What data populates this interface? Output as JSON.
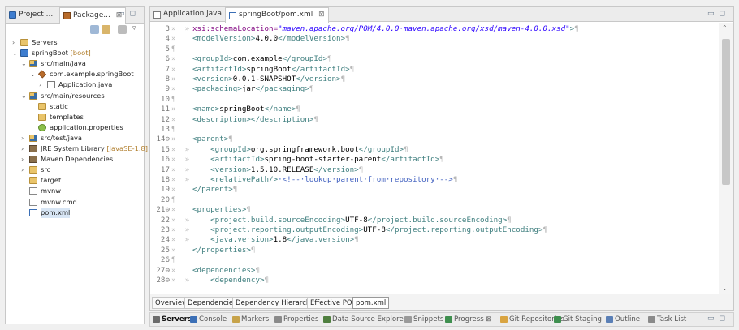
{
  "left_panel": {
    "tabs": [
      {
        "label": "Project ...",
        "active": false
      },
      {
        "label": "Package...",
        "active": true,
        "close": "⊠"
      }
    ],
    "tree": [
      {
        "label": "Servers",
        "decoration": "",
        "depth": 0,
        "twisty": "›",
        "icon": "folder"
      },
      {
        "label": "springBoot",
        "decoration": "[boot]",
        "depth": 0,
        "twisty": "⌄",
        "icon": "project"
      },
      {
        "label": "src/main/java",
        "decoration": "",
        "depth": 1,
        "twisty": "⌄",
        "icon": "srcfolder"
      },
      {
        "label": "com.example.springBoot",
        "decoration": "",
        "depth": 2,
        "twisty": "⌄",
        "icon": "package"
      },
      {
        "label": "Application.java",
        "decoration": "",
        "depth": 3,
        "twisty": "›",
        "icon": "java"
      },
      {
        "label": "src/main/resources",
        "decoration": "",
        "depth": 1,
        "twisty": "⌄",
        "icon": "srcfolder"
      },
      {
        "label": "static",
        "decoration": "",
        "depth": 2,
        "twisty": "",
        "icon": "folder"
      },
      {
        "label": "templates",
        "decoration": "",
        "depth": 2,
        "twisty": "",
        "icon": "folder"
      },
      {
        "label": "application.properties",
        "decoration": "",
        "depth": 2,
        "twisty": "",
        "icon": "props"
      },
      {
        "label": "src/test/java",
        "decoration": "",
        "depth": 1,
        "twisty": "›",
        "icon": "srcfolder"
      },
      {
        "label": "JRE System Library",
        "decoration": "[JavaSE-1.8]",
        "depth": 1,
        "twisty": "›",
        "icon": "lib"
      },
      {
        "label": "Maven Dependencies",
        "decoration": "",
        "depth": 1,
        "twisty": "›",
        "icon": "lib"
      },
      {
        "label": "src",
        "decoration": "",
        "depth": 1,
        "twisty": "›",
        "icon": "folder"
      },
      {
        "label": "target",
        "decoration": "",
        "depth": 1,
        "twisty": "",
        "icon": "folder"
      },
      {
        "label": "mvnw",
        "decoration": "",
        "depth": 1,
        "twisty": "",
        "icon": "file"
      },
      {
        "label": "mvnw.cmd",
        "decoration": "",
        "depth": 1,
        "twisty": "",
        "icon": "file"
      },
      {
        "label": "pom.xml",
        "decoration": "",
        "depth": 1,
        "twisty": "",
        "icon": "xml",
        "selected": true
      }
    ]
  },
  "editor": {
    "tabs": [
      {
        "label": "Application.java",
        "active": false
      },
      {
        "label": "springBoot/pom.xml",
        "active": true,
        "close": "⊠"
      }
    ],
    "lines": [
      {
        "n": "3",
        "marks": "»  »",
        "segs": [
          {
            "c": "attr",
            "t": "xsi:schemaLocation="
          },
          {
            "c": "str",
            "t": "\"maven.apache.org/POM/4.0.0·maven.apache.org/xsd/maven-4.0.0.xsd\""
          },
          {
            "c": "tag",
            "t": ">"
          },
          {
            "c": "pil",
            "t": "¶"
          }
        ]
      },
      {
        "n": "4",
        "marks": "»",
        "segs": [
          {
            "c": "tag",
            "t": "<modelVersion>"
          },
          {
            "c": "txt",
            "t": "4.0.0"
          },
          {
            "c": "tag",
            "t": "</modelVersion>"
          },
          {
            "c": "pil",
            "t": "¶"
          }
        ]
      },
      {
        "n": "5",
        "marks": "¶",
        "segs": []
      },
      {
        "n": "6",
        "marks": "»",
        "segs": [
          {
            "c": "tag",
            "t": "<groupId>"
          },
          {
            "c": "txt",
            "t": "com.example"
          },
          {
            "c": "tag",
            "t": "</groupId>"
          },
          {
            "c": "pil",
            "t": "¶"
          }
        ]
      },
      {
        "n": "7",
        "marks": "»",
        "segs": [
          {
            "c": "tag",
            "t": "<artifactId>"
          },
          {
            "c": "txt",
            "t": "springBoot"
          },
          {
            "c": "tag",
            "t": "</artifactId>"
          },
          {
            "c": "pil",
            "t": "¶"
          }
        ]
      },
      {
        "n": "8",
        "marks": "»",
        "segs": [
          {
            "c": "tag",
            "t": "<version>"
          },
          {
            "c": "txt",
            "t": "0.0.1-SNAPSHOT"
          },
          {
            "c": "tag",
            "t": "</version>"
          },
          {
            "c": "pil",
            "t": "¶"
          }
        ]
      },
      {
        "n": "9",
        "marks": "»",
        "segs": [
          {
            "c": "tag",
            "t": "<packaging>"
          },
          {
            "c": "txt",
            "t": "jar"
          },
          {
            "c": "tag",
            "t": "</packaging>"
          },
          {
            "c": "pil",
            "t": "¶"
          }
        ]
      },
      {
        "n": "10",
        "marks": "¶",
        "segs": []
      },
      {
        "n": "11",
        "marks": "»",
        "segs": [
          {
            "c": "tag",
            "t": "<name>"
          },
          {
            "c": "txt",
            "t": "springBoot"
          },
          {
            "c": "tag",
            "t": "</name>"
          },
          {
            "c": "pil",
            "t": "¶"
          }
        ]
      },
      {
        "n": "12",
        "marks": "»",
        "segs": [
          {
            "c": "tag",
            "t": "<description></description>"
          },
          {
            "c": "pil",
            "t": "¶"
          }
        ]
      },
      {
        "n": "13",
        "marks": "¶",
        "segs": []
      },
      {
        "n": "14⊖",
        "marks": "»",
        "segs": [
          {
            "c": "tag",
            "t": "<parent>"
          },
          {
            "c": "pil",
            "t": "¶"
          }
        ]
      },
      {
        "n": "15",
        "marks": "»  »",
        "segs": [
          {
            "c": "tag",
            "t": "    <groupId>"
          },
          {
            "c": "txt",
            "t": "org.springframework.boot"
          },
          {
            "c": "tag",
            "t": "</groupId>"
          },
          {
            "c": "pil",
            "t": "¶"
          }
        ]
      },
      {
        "n": "16",
        "marks": "»  »",
        "segs": [
          {
            "c": "tag",
            "t": "    <artifactId>"
          },
          {
            "c": "txt",
            "t": "spring-boot-starter-parent"
          },
          {
            "c": "tag",
            "t": "</artifactId>"
          },
          {
            "c": "pil",
            "t": "¶"
          }
        ]
      },
      {
        "n": "17",
        "marks": "»  »",
        "segs": [
          {
            "c": "tag",
            "t": "    <version>"
          },
          {
            "c": "txt",
            "t": "1.5.10.RELEASE"
          },
          {
            "c": "tag",
            "t": "</version>"
          },
          {
            "c": "pil",
            "t": "¶"
          }
        ]
      },
      {
        "n": "18",
        "marks": "»  »",
        "segs": [
          {
            "c": "tag",
            "t": "    <relativePath/>"
          },
          {
            "c": "com",
            "t": "·<!--·lookup·parent·from·repository·-->"
          },
          {
            "c": "pil",
            "t": "¶"
          }
        ]
      },
      {
        "n": "19",
        "marks": "»",
        "segs": [
          {
            "c": "tag",
            "t": "</parent>"
          },
          {
            "c": "pil",
            "t": "¶"
          }
        ]
      },
      {
        "n": "20",
        "marks": "¶",
        "segs": []
      },
      {
        "n": "21⊖",
        "marks": "»",
        "segs": [
          {
            "c": "tag",
            "t": "<properties>"
          },
          {
            "c": "pil",
            "t": "¶"
          }
        ]
      },
      {
        "n": "22",
        "marks": "»  »",
        "segs": [
          {
            "c": "tag",
            "t": "    <project.build.sourceEncoding>"
          },
          {
            "c": "txt",
            "t": "UTF-8"
          },
          {
            "c": "tag",
            "t": "</project.build.sourceEncoding>"
          },
          {
            "c": "pil",
            "t": "¶"
          }
        ]
      },
      {
        "n": "23",
        "marks": "»  »",
        "segs": [
          {
            "c": "tag",
            "t": "    <project.reporting.outputEncoding>"
          },
          {
            "c": "txt",
            "t": "UTF-8"
          },
          {
            "c": "tag",
            "t": "</project.reporting.outputEncoding>"
          },
          {
            "c": "pil",
            "t": "¶"
          }
        ]
      },
      {
        "n": "24",
        "marks": "»  »",
        "segs": [
          {
            "c": "tag",
            "t": "    <java.version>"
          },
          {
            "c": "txt",
            "t": "1.8"
          },
          {
            "c": "tag",
            "t": "</java.version>"
          },
          {
            "c": "pil",
            "t": "¶"
          }
        ]
      },
      {
        "n": "25",
        "marks": "»",
        "segs": [
          {
            "c": "tag",
            "t": "</properties>"
          },
          {
            "c": "pil",
            "t": "¶"
          }
        ]
      },
      {
        "n": "26",
        "marks": "¶",
        "segs": []
      },
      {
        "n": "27⊖",
        "marks": "»",
        "segs": [
          {
            "c": "tag",
            "t": "<dependencies>"
          },
          {
            "c": "pil",
            "t": "¶"
          }
        ]
      },
      {
        "n": "28⊖",
        "marks": "»  »",
        "segs": [
          {
            "c": "tag",
            "t": "    <dependency>"
          },
          {
            "c": "pil",
            "t": "¶"
          }
        ]
      }
    ],
    "bottom_tabs": [
      {
        "label": "Overview",
        "active": false
      },
      {
        "label": "Dependencies",
        "active": false
      },
      {
        "label": "Dependency Hierarchy",
        "active": false
      },
      {
        "label": "Effective POM",
        "active": false
      },
      {
        "label": "pom.xml",
        "active": true
      }
    ]
  },
  "bottom_views": [
    {
      "label": "Servers",
      "icon": "servers-icon",
      "active": true
    },
    {
      "label": "Console",
      "icon": "console-icon",
      "active": false
    },
    {
      "label": "Markers",
      "icon": "markers-icon",
      "active": false
    },
    {
      "label": "Properties",
      "icon": "properties-icon",
      "active": false
    },
    {
      "label": "Data Source Explorer",
      "icon": "datasource-icon",
      "active": false
    },
    {
      "label": "Snippets",
      "icon": "snippets-icon",
      "active": false
    },
    {
      "label": "Progress ⊠",
      "icon": "progress-icon",
      "active": false
    },
    {
      "label": "Git Repositories",
      "icon": "git-repo-icon",
      "active": false
    },
    {
      "label": "Git Staging",
      "icon": "git-staging-icon",
      "active": false
    },
    {
      "label": "Outline",
      "icon": "outline-icon",
      "active": false
    },
    {
      "label": "Task List",
      "icon": "tasklist-icon",
      "active": false
    }
  ],
  "colors": {
    "xml_tag": "#3f7f7f",
    "xml_attr": "#7f007f",
    "xml_string": "#2a00ff",
    "xml_comment": "#3f5fbf",
    "selection": "#d8e6f5"
  }
}
